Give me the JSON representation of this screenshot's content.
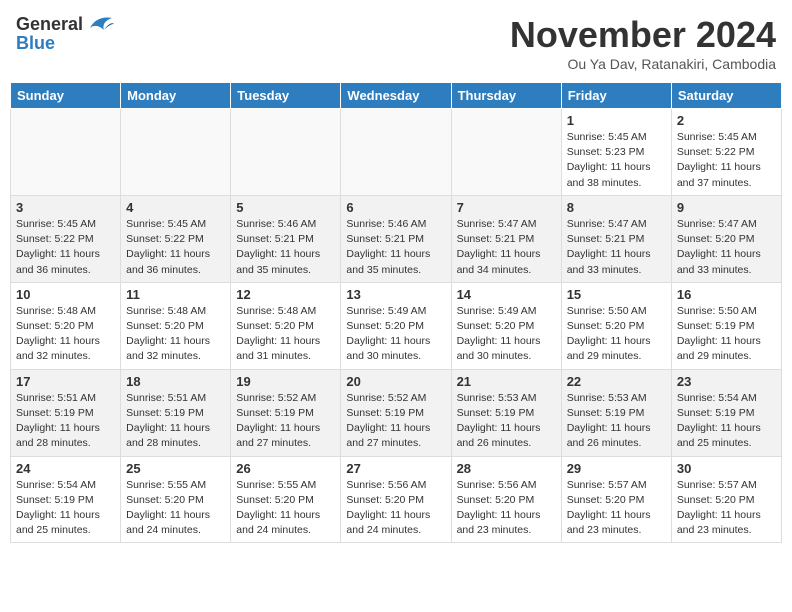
{
  "header": {
    "logo_general": "General",
    "logo_blue": "Blue",
    "month_title": "November 2024",
    "location": "Ou Ya Dav, Ratanakiri, Cambodia"
  },
  "days_of_week": [
    "Sunday",
    "Monday",
    "Tuesday",
    "Wednesday",
    "Thursday",
    "Friday",
    "Saturday"
  ],
  "weeks": [
    {
      "cells": [
        {
          "day": "",
          "info": "",
          "empty": true
        },
        {
          "day": "",
          "info": "",
          "empty": true
        },
        {
          "day": "",
          "info": "",
          "empty": true
        },
        {
          "day": "",
          "info": "",
          "empty": true
        },
        {
          "day": "",
          "info": "",
          "empty": true
        },
        {
          "day": "1",
          "info": "Sunrise: 5:45 AM\nSunset: 5:23 PM\nDaylight: 11 hours\nand 38 minutes."
        },
        {
          "day": "2",
          "info": "Sunrise: 5:45 AM\nSunset: 5:22 PM\nDaylight: 11 hours\nand 37 minutes."
        }
      ]
    },
    {
      "cells": [
        {
          "day": "3",
          "info": "Sunrise: 5:45 AM\nSunset: 5:22 PM\nDaylight: 11 hours\nand 36 minutes."
        },
        {
          "day": "4",
          "info": "Sunrise: 5:45 AM\nSunset: 5:22 PM\nDaylight: 11 hours\nand 36 minutes."
        },
        {
          "day": "5",
          "info": "Sunrise: 5:46 AM\nSunset: 5:21 PM\nDaylight: 11 hours\nand 35 minutes."
        },
        {
          "day": "6",
          "info": "Sunrise: 5:46 AM\nSunset: 5:21 PM\nDaylight: 11 hours\nand 35 minutes."
        },
        {
          "day": "7",
          "info": "Sunrise: 5:47 AM\nSunset: 5:21 PM\nDaylight: 11 hours\nand 34 minutes."
        },
        {
          "day": "8",
          "info": "Sunrise: 5:47 AM\nSunset: 5:21 PM\nDaylight: 11 hours\nand 33 minutes."
        },
        {
          "day": "9",
          "info": "Sunrise: 5:47 AM\nSunset: 5:20 PM\nDaylight: 11 hours\nand 33 minutes."
        }
      ]
    },
    {
      "cells": [
        {
          "day": "10",
          "info": "Sunrise: 5:48 AM\nSunset: 5:20 PM\nDaylight: 11 hours\nand 32 minutes."
        },
        {
          "day": "11",
          "info": "Sunrise: 5:48 AM\nSunset: 5:20 PM\nDaylight: 11 hours\nand 32 minutes."
        },
        {
          "day": "12",
          "info": "Sunrise: 5:48 AM\nSunset: 5:20 PM\nDaylight: 11 hours\nand 31 minutes."
        },
        {
          "day": "13",
          "info": "Sunrise: 5:49 AM\nSunset: 5:20 PM\nDaylight: 11 hours\nand 30 minutes."
        },
        {
          "day": "14",
          "info": "Sunrise: 5:49 AM\nSunset: 5:20 PM\nDaylight: 11 hours\nand 30 minutes."
        },
        {
          "day": "15",
          "info": "Sunrise: 5:50 AM\nSunset: 5:20 PM\nDaylight: 11 hours\nand 29 minutes."
        },
        {
          "day": "16",
          "info": "Sunrise: 5:50 AM\nSunset: 5:19 PM\nDaylight: 11 hours\nand 29 minutes."
        }
      ]
    },
    {
      "cells": [
        {
          "day": "17",
          "info": "Sunrise: 5:51 AM\nSunset: 5:19 PM\nDaylight: 11 hours\nand 28 minutes."
        },
        {
          "day": "18",
          "info": "Sunrise: 5:51 AM\nSunset: 5:19 PM\nDaylight: 11 hours\nand 28 minutes."
        },
        {
          "day": "19",
          "info": "Sunrise: 5:52 AM\nSunset: 5:19 PM\nDaylight: 11 hours\nand 27 minutes."
        },
        {
          "day": "20",
          "info": "Sunrise: 5:52 AM\nSunset: 5:19 PM\nDaylight: 11 hours\nand 27 minutes."
        },
        {
          "day": "21",
          "info": "Sunrise: 5:53 AM\nSunset: 5:19 PM\nDaylight: 11 hours\nand 26 minutes."
        },
        {
          "day": "22",
          "info": "Sunrise: 5:53 AM\nSunset: 5:19 PM\nDaylight: 11 hours\nand 26 minutes."
        },
        {
          "day": "23",
          "info": "Sunrise: 5:54 AM\nSunset: 5:19 PM\nDaylight: 11 hours\nand 25 minutes."
        }
      ]
    },
    {
      "cells": [
        {
          "day": "24",
          "info": "Sunrise: 5:54 AM\nSunset: 5:19 PM\nDaylight: 11 hours\nand 25 minutes."
        },
        {
          "day": "25",
          "info": "Sunrise: 5:55 AM\nSunset: 5:20 PM\nDaylight: 11 hours\nand 24 minutes."
        },
        {
          "day": "26",
          "info": "Sunrise: 5:55 AM\nSunset: 5:20 PM\nDaylight: 11 hours\nand 24 minutes."
        },
        {
          "day": "27",
          "info": "Sunrise: 5:56 AM\nSunset: 5:20 PM\nDaylight: 11 hours\nand 24 minutes."
        },
        {
          "day": "28",
          "info": "Sunrise: 5:56 AM\nSunset: 5:20 PM\nDaylight: 11 hours\nand 23 minutes."
        },
        {
          "day": "29",
          "info": "Sunrise: 5:57 AM\nSunset: 5:20 PM\nDaylight: 11 hours\nand 23 minutes."
        },
        {
          "day": "30",
          "info": "Sunrise: 5:57 AM\nSunset: 5:20 PM\nDaylight: 11 hours\nand 23 minutes."
        }
      ]
    }
  ]
}
